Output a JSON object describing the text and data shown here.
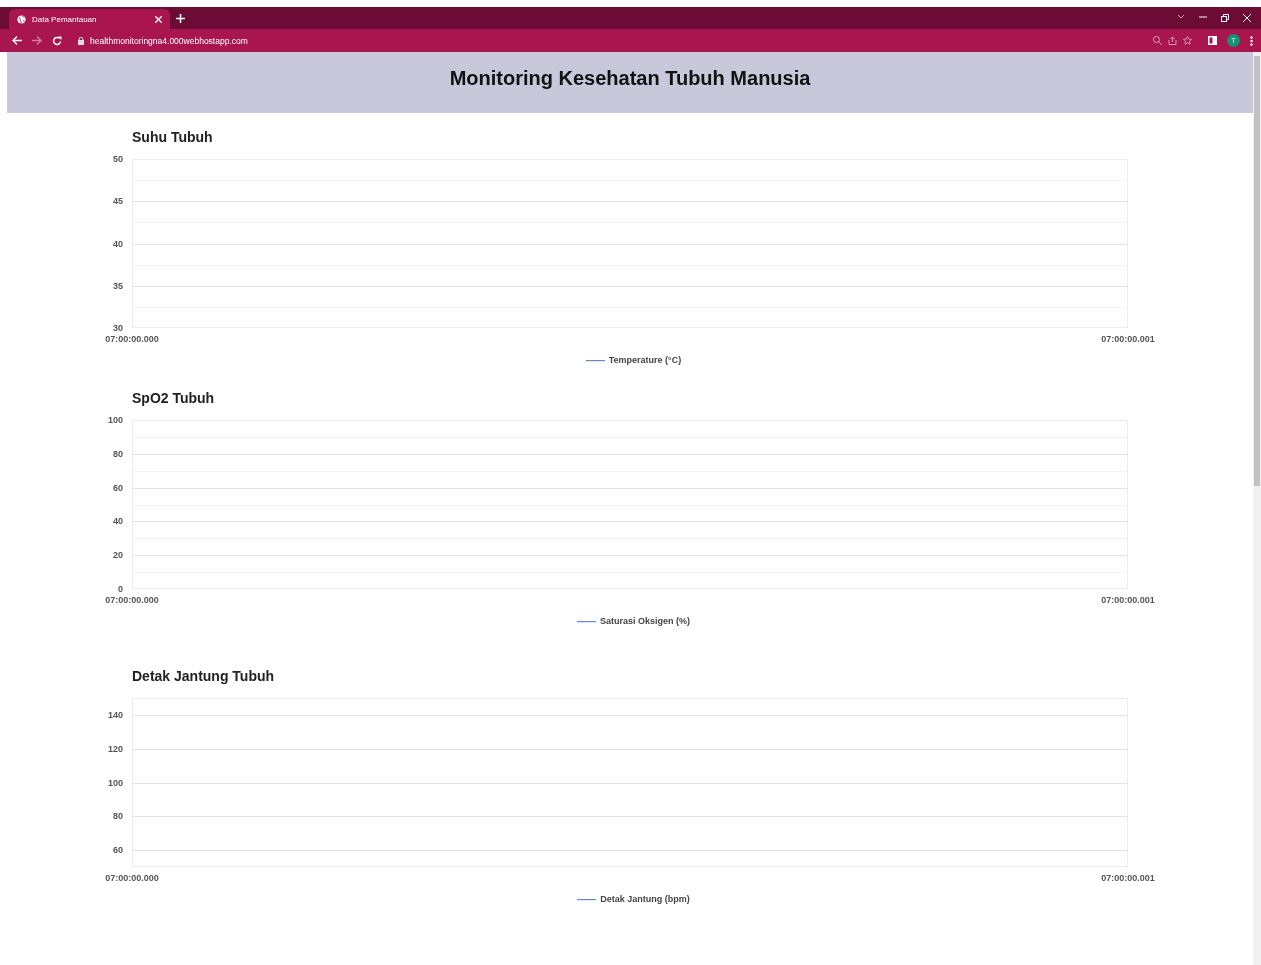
{
  "browser": {
    "tabs": [
      {
        "title": "Data Pemantauan",
        "selected": true
      }
    ],
    "address": "healthmonitoringna4.000webhostapp.com",
    "profile_initial": "T"
  },
  "page": {
    "title": "Monitoring Kesehatan Tubuh Manusia"
  },
  "charts": [
    {
      "title": "Suhu Tubuh",
      "chart_data": {
        "type": "line",
        "categories": [
          "07:00:00.000",
          "07:00:00.001"
        ],
        "ylim": [
          30,
          50
        ],
        "yticks": [
          30,
          35,
          40,
          45,
          50
        ],
        "series": [
          {
            "name": "Temperature (°C)",
            "color": "#5b8bd0",
            "values": [
              null,
              null
            ]
          }
        ]
      }
    },
    {
      "title": "SpO2 Tubuh",
      "chart_data": {
        "type": "line",
        "categories": [
          "07:00:00.000",
          "07:00:00.001"
        ],
        "ylim": [
          0,
          100
        ],
        "yticks": [
          0,
          20,
          40,
          60,
          80,
          100
        ],
        "series": [
          {
            "name": "Saturasi Oksigen (%)",
            "color": "#5b8bd0",
            "values": [
              null,
              null
            ]
          }
        ]
      }
    },
    {
      "title": "Detak Jantung Tubuh",
      "chart_data": {
        "type": "line",
        "categories": [
          "07:00:00.000",
          "07:00:00.001"
        ],
        "ylim": [
          50,
          150
        ],
        "yticks": [
          60,
          80,
          100,
          120,
          140
        ],
        "series": [
          {
            "name": "Detak Jantung (bpm)",
            "color": "#5b8bd0",
            "values": [
              null,
              null
            ]
          }
        ]
      }
    }
  ]
}
